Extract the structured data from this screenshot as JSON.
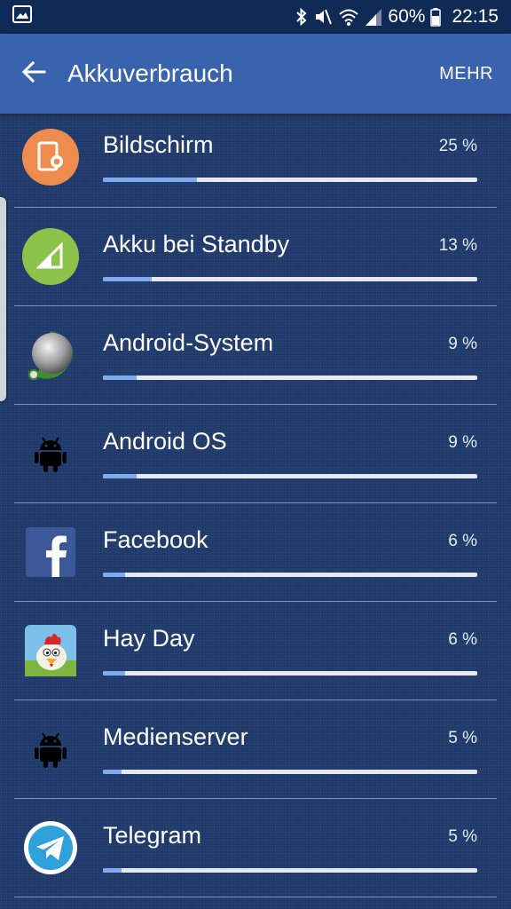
{
  "status_bar": {
    "battery_percent": "60%",
    "time": "22:15",
    "icons": [
      "image-icon",
      "bluetooth-icon",
      "mute-icon",
      "wifi-icon",
      "signal-icon",
      "battery-icon"
    ]
  },
  "app_bar": {
    "title": "Akkuverbrauch",
    "more_label": "MEHR",
    "back_icon": "arrow-left-icon",
    "color": "#3a63ad"
  },
  "accent_color": "#7eaaf0",
  "items": [
    {
      "name": "Bildschirm",
      "percent_label": "25 %",
      "percent": 25,
      "icon": "screen-brightness-icon"
    },
    {
      "name": "Akku bei Standby",
      "percent_label": "13 %",
      "percent": 13,
      "icon": "cell-standby-icon"
    },
    {
      "name": "Android-System",
      "percent_label": "9 %",
      "percent": 9,
      "icon": "android-system-icon"
    },
    {
      "name": "Android OS",
      "percent_label": "9 %",
      "percent": 9,
      "icon": "android-robot-icon"
    },
    {
      "name": "Facebook",
      "percent_label": "6 %",
      "percent": 6,
      "icon": "facebook-icon"
    },
    {
      "name": "Hay Day",
      "percent_label": "6 %",
      "percent": 6,
      "icon": "hay-day-icon"
    },
    {
      "name": "Medienserver",
      "percent_label": "5 %",
      "percent": 5,
      "icon": "android-robot-icon"
    },
    {
      "name": "Telegram",
      "percent_label": "5 %",
      "percent": 5,
      "icon": "telegram-icon"
    }
  ]
}
